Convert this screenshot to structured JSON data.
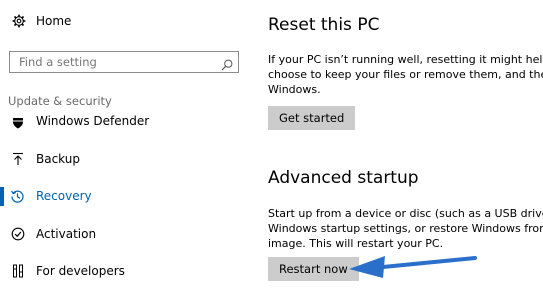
{
  "sidebar": {
    "home_label": "Home",
    "search": {
      "placeholder": "Find a setting"
    },
    "section_label": "Update & security",
    "items": [
      {
        "label": "Windows Defender",
        "icon": "shield-icon"
      },
      {
        "label": "Backup",
        "icon": "backup-arrow-icon"
      },
      {
        "label": "Recovery",
        "icon": "recovery-history-icon",
        "active": true
      },
      {
        "label": "Activation",
        "icon": "check-circle-icon"
      },
      {
        "label": "For developers",
        "icon": "developer-tools-icon"
      }
    ]
  },
  "main": {
    "reset": {
      "title": "Reset this PC",
      "lines": [
        "If your PC isn’t running well, resetting it might help. Th",
        "choose to keep your files or remove them, and then re",
        "Windows."
      ],
      "button": "Get started"
    },
    "advanced": {
      "title": "Advanced startup",
      "lines": [
        "Start up from a device or disc (such as a USB drive or ",
        "Windows startup settings, or restore Windows from a",
        "image. This will restart your PC."
      ],
      "button": "Restart now"
    }
  },
  "colors": {
    "accent": "#0063b1",
    "button_bg": "#cccccc",
    "annotation_arrow": "#2a6fc9"
  }
}
